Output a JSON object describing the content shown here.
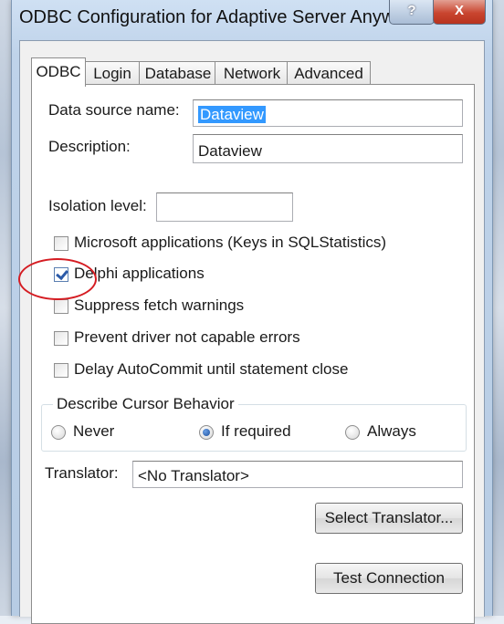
{
  "window": {
    "title": "ODBC Configuration for Adaptive Server Anyw...",
    "help_glyph": "?",
    "close_glyph": "X"
  },
  "tabs": [
    {
      "label": "ODBC",
      "active": true
    },
    {
      "label": "Login",
      "active": false
    },
    {
      "label": "Database",
      "active": false
    },
    {
      "label": "Network",
      "active": false
    },
    {
      "label": "Advanced",
      "active": false
    }
  ],
  "form": {
    "dsn_label": "Data source name:",
    "dsn_value": "Dataview",
    "description_label": "Description:",
    "description_value": "Dataview",
    "isolation_label": "Isolation level:",
    "isolation_value": ""
  },
  "options": [
    {
      "label": "Microsoft applications (Keys in SQLStatistics)",
      "checked": false
    },
    {
      "label": "Delphi applications",
      "checked": true
    },
    {
      "label": "Suppress fetch warnings",
      "checked": false
    },
    {
      "label": "Prevent driver not capable errors",
      "checked": false
    },
    {
      "label": "Delay AutoCommit until statement close",
      "checked": false
    }
  ],
  "cursor_behavior": {
    "title": "Describe Cursor Behavior",
    "options": [
      {
        "label": "Never",
        "selected": false
      },
      {
        "label": "If required",
        "selected": true
      },
      {
        "label": "Always",
        "selected": false
      }
    ]
  },
  "translator": {
    "label": "Translator:",
    "value": "<No Translator>",
    "select_button": "Select Translator..."
  },
  "test_button": "Test Connection",
  "annotation_color": "#d51c22"
}
